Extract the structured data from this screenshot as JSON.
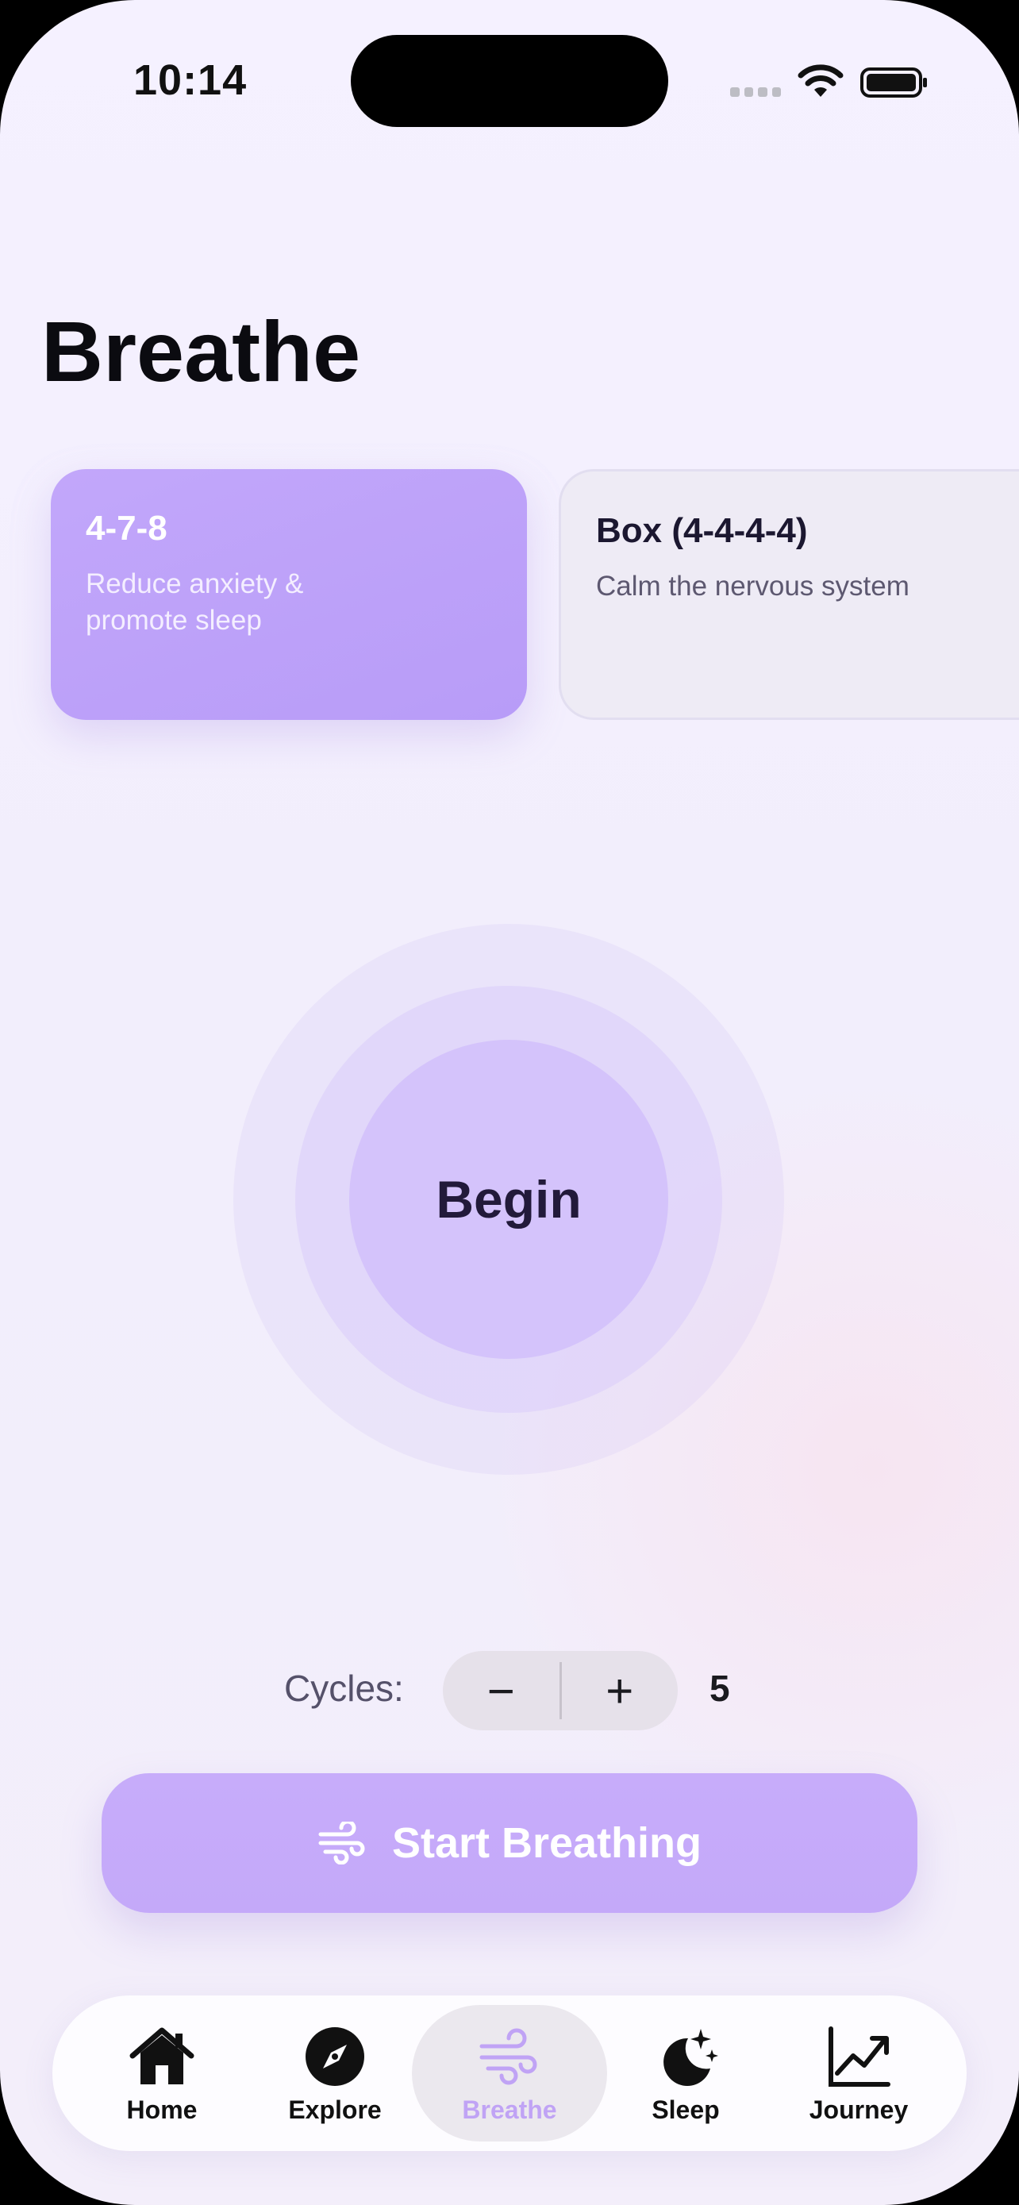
{
  "status_bar": {
    "time": "10:14"
  },
  "page": {
    "title": "Breathe"
  },
  "techniques": [
    {
      "name": "4-7-8",
      "description": "Reduce anxiety & promote sleep",
      "selected": true
    },
    {
      "name": "Box (4-4-4-4)",
      "description": "Calm the nervous system",
      "selected": false
    }
  ],
  "breath_circle": {
    "label": "Begin"
  },
  "cycles": {
    "label": "Cycles:",
    "decrement": "−",
    "increment": "+",
    "value": "5"
  },
  "start_button": {
    "label": "Start Breathing",
    "icon": "wind-icon"
  },
  "tab_bar": {
    "items": [
      {
        "label": "Home",
        "icon": "home-icon"
      },
      {
        "label": "Explore",
        "icon": "compass-icon"
      },
      {
        "label": "Breathe",
        "icon": "wind-icon",
        "active": true
      },
      {
        "label": "Sleep",
        "icon": "moon-stars-icon"
      },
      {
        "label": "Journey",
        "icon": "chart-up-icon"
      }
    ]
  },
  "colors": {
    "accent": "#c0a3f5",
    "card_active": "#bca0f8",
    "circle": "#d4c3fb",
    "background": "#f4f0fd"
  }
}
